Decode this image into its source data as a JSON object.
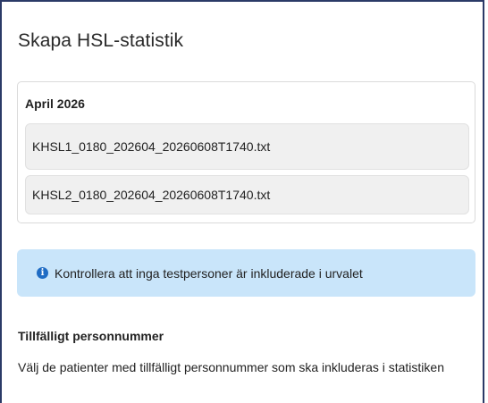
{
  "dialog": {
    "title": "Skapa HSL-statistik"
  },
  "period": {
    "heading": "April 2026",
    "files": [
      "KHSL1_0180_202604_20260608T1740.txt",
      "KHSL2_0180_202604_20260608T1740.txt"
    ]
  },
  "alert": {
    "icon": "info-circle-icon",
    "icon_glyph": "i",
    "text": "Kontrollera att inga testpersoner är inkluderade i urvalet",
    "color": "#c9e5fa"
  },
  "temp_id_section": {
    "heading": "Tillfälligt personnummer",
    "description": "Välj de patienter med tillfälligt personnummer som ska inkluderas i statistiken"
  }
}
